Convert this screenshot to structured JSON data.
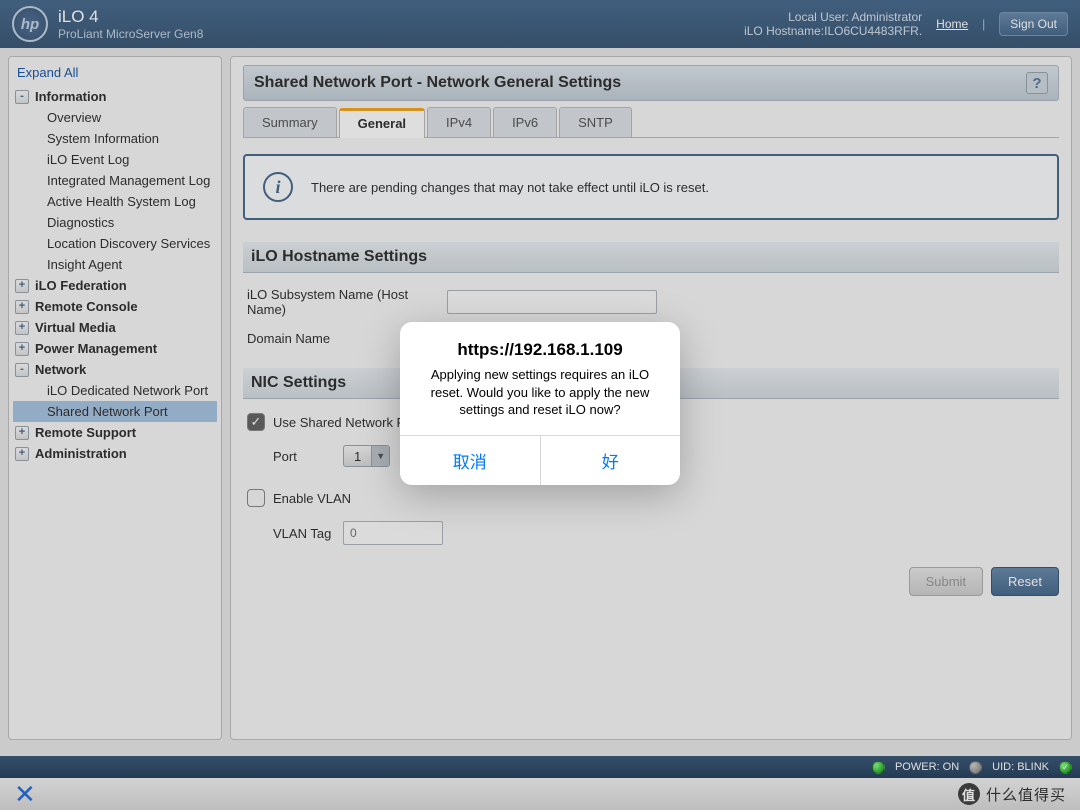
{
  "header": {
    "logo_text": "hp",
    "title": "iLO 4",
    "subtitle": "ProLiant MicroServer Gen8",
    "local_user": "Local User:  Administrator",
    "hostname": "iLO Hostname:ILO6CU4483RFR.",
    "home": "Home",
    "signout": "Sign Out"
  },
  "sidebar": {
    "expand_all": "Expand All",
    "information": {
      "label": "Information",
      "items": [
        "Overview",
        "System Information",
        "iLO Event Log",
        "Integrated Management Log",
        "Active Health System Log",
        "Diagnostics",
        "Location Discovery Services",
        "Insight Agent"
      ]
    },
    "federation": "iLO Federation",
    "remote_console": "Remote Console",
    "virtual_media": "Virtual Media",
    "power_mgmt": "Power Management",
    "network": {
      "label": "Network",
      "items": [
        "iLO Dedicated Network Port",
        "Shared Network Port"
      ]
    },
    "remote_support": "Remote Support",
    "administration": "Administration"
  },
  "content": {
    "title": "Shared Network Port - Network General Settings",
    "help": "?",
    "tabs": [
      "Summary",
      "General",
      "IPv4",
      "IPv6",
      "SNTP"
    ],
    "alert": "There are pending changes that may not take effect until iLO is reset.",
    "section_hostname": "iLO Hostname Settings",
    "label_subsystem": "iLO Subsystem Name (Host Name)",
    "value_subsystem": "",
    "label_domain": "Domain Name",
    "section_nic": "NIC Settings",
    "chk_shared": "Use Shared Network Port",
    "label_port": "Port",
    "port_value": "1",
    "chk_vlan": "Enable VLAN",
    "label_vlantag": "VLAN Tag",
    "vlantag_placeholder": "0",
    "btn_submit": "Submit",
    "btn_reset": "Reset"
  },
  "statusbar": {
    "power": "POWER: ON",
    "uid": "UID: BLINK"
  },
  "bottombar": {
    "brand_char": "值",
    "brand_text": "什么值得买"
  },
  "modal": {
    "title": "https://192.168.1.109",
    "body": "Applying new settings requires an iLO reset.  Would you like to apply the new settings and reset iLO now?",
    "cancel": "取消",
    "ok": "好"
  }
}
